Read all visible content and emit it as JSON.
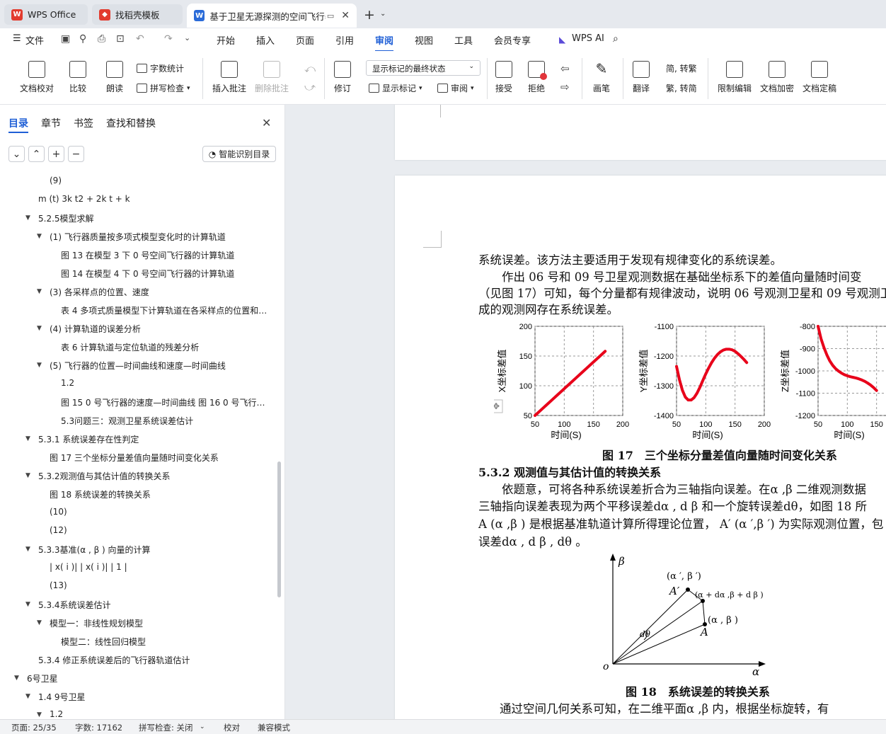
{
  "tabs": {
    "wps": "WPS Office",
    "template": "找稻壳模板",
    "document": "基于卫星无源探测的空间飞行器"
  },
  "menu": {
    "file": "文件",
    "items": [
      "开始",
      "插入",
      "页面",
      "引用",
      "审阅",
      "视图",
      "工具",
      "会员专享"
    ],
    "ai": "WPS AI",
    "active": "审阅"
  },
  "ribbon": {
    "proofread": "文档校对",
    "compare": "比较",
    "read": "朗读",
    "wordcount": "字数统计",
    "spellcheck": "拼写检查",
    "insert_comment": "插入批注",
    "delete_comment": "删除批注",
    "track": "修订",
    "markup_state": "显示标记的最终状态",
    "show_markup": "显示标记",
    "review": "审阅",
    "accept": "接受",
    "reject": "拒绝",
    "pen": "画笔",
    "translate": "翻译",
    "to_trad": "简, 转繁",
    "to_simp": "繁, 转简",
    "restrict": "限制编辑",
    "encrypt": "文档加密",
    "finalize": "文档定稿"
  },
  "nav": {
    "tabs": [
      "目录",
      "章节",
      "书签",
      "查找和替换"
    ],
    "smart_toc": "智能识别目录",
    "items": [
      {
        "text": "(9)",
        "caret": false
      },
      {
        "text": "m (t)  3k t2 + 2k t + k",
        "caret": false
      },
      {
        "text": "5.2.5模型求解",
        "caret": true
      },
      {
        "text": "(1) 飞行器质量按多项式模型变化时的计算轨道",
        "caret": true
      },
      {
        "text": "图 13 在模型 3 下 0 号空间飞行器的计算轨道",
        "caret": false
      },
      {
        "text": "图 14 在模型 4 下 0 号空间飞行器的计算轨道",
        "caret": false
      },
      {
        "text": "(3) 各采样点的位置、速度",
        "caret": true
      },
      {
        "text": "表 4 多项式质量模型下计算轨道在各采样点的位置和…",
        "caret": false
      },
      {
        "text": "(4) 计算轨道的误差分析",
        "caret": true
      },
      {
        "text": "表 6 计算轨道与定位轨道的残差分析",
        "caret": false
      },
      {
        "text": "(5) 飞行器的位置—时间曲线和速度—时间曲线",
        "caret": true
      },
      {
        "text": "1.2",
        "caret": false
      },
      {
        "text": "图 15 0 号飞行器的速度—时间曲线 图 16 0 号飞行…",
        "caret": false
      },
      {
        "text": "5.3问题三：观测卫星系统误差估计",
        "caret": false
      },
      {
        "text": "5.3.1 系统误差存在性判定",
        "caret": true
      },
      {
        "text": "图 17 三个坐标分量差值向量随时间变化关系",
        "caret": false
      },
      {
        "text": "5.3.2观测值与其估计值的转换关系",
        "caret": true
      },
      {
        "text": "图 18 系统误差的转换关系",
        "caret": false
      },
      {
        "text": "(10)",
        "caret": false
      },
      {
        "text": "(12)",
        "caret": false
      },
      {
        "text": "5.3.3基准(α , β ) 向量的计算",
        "caret": true
      },
      {
        "text": "|  x( i )|   |   x( i )|   |  1 |",
        "caret": false
      },
      {
        "text": "(13)",
        "caret": false
      },
      {
        "text": "5.3.4系统误差估计",
        "caret": true
      },
      {
        "text": "模型一：非线性规划模型",
        "caret": true
      },
      {
        "text": "模型二：线性回归模型",
        "caret": false
      },
      {
        "text": "5.3.4 修正系统误差后的飞行器轨道估计",
        "caret": false
      },
      {
        "text": "6号卫星",
        "caret": true
      },
      {
        "text": "1.4 9号卫星",
        "caret": true
      },
      {
        "text": "1.2",
        "caret": true
      }
    ]
  },
  "doc": {
    "lines": [
      "系统误差。该方法主要适用于发现有规律变化的系统误差。",
      "作出 06 号和 09 号卫星观测数据在基础坐标系下的差值向量随时间变",
      "（见图 17）可知，每个分量都有规律波动，说明 06 号观测卫星和 09 号观测卫",
      "成的观测网存在系统误差。"
    ],
    "fig17_caption": "图 17　三个坐标分量差值向量随时间变化关系",
    "heading_532": "5.3.2 观测值与其估计值的转换关系",
    "para2": [
      "依题意，可将各种系统误差折合为三轴指向误差。在α ,β 二维观测数据",
      "三轴指向误差表现为两个平移误差dα , d β 和一个旋转误差dθ，如图 18 所",
      "A (α ,β ) 是根据基准轨道计算所得理论位置， A′ (α ′,β ′) 为实际观测位置，包",
      "误差dα , d β , dθ 。"
    ],
    "fig18_caption": "图 18　系统误差的转换关系",
    "fig18_labels": {
      "beta": "β",
      "alpha": "α",
      "origin": "o",
      "Aprime": "A′",
      "Aprime_coord": "(α ′, β ′)",
      "A": "A",
      "A_coord": "(α , β )",
      "mid": "(α + dα ,β + d β )",
      "dtheta": "dθ"
    },
    "para3": "通过空间几何关系可知，在二维平面α ,β 内，根据坐标旋转，有"
  },
  "chart_data": [
    {
      "type": "line",
      "ylabel": "X坐标差值",
      "xlabel": "时间(S)",
      "xlim": [
        50,
        200
      ],
      "ylim": [
        50,
        200
      ],
      "xticks": [
        50,
        100,
        150,
        200
      ],
      "yticks": [
        50,
        100,
        150,
        200
      ],
      "grid": true,
      "series": [
        {
          "x": [
            50,
            60,
            70,
            80,
            90,
            100,
            110,
            120,
            130,
            140,
            150,
            160,
            170
          ],
          "y": [
            50,
            59,
            68,
            77,
            86,
            95,
            104,
            113,
            122,
            131,
            140,
            149,
            158
          ]
        }
      ]
    },
    {
      "type": "line",
      "ylabel": "Y坐标差值",
      "xlabel": "时间(S)",
      "xlim": [
        50,
        200
      ],
      "ylim": [
        -1400,
        -1100
      ],
      "xticks": [
        50,
        100,
        150,
        200
      ],
      "yticks": [
        -1100,
        -1200,
        -1300,
        -1400
      ],
      "grid": true,
      "series": [
        {
          "x": [
            50,
            55,
            60,
            65,
            70,
            75,
            80,
            85,
            90,
            95,
            100,
            105,
            110,
            115,
            120,
            125,
            130,
            135,
            140,
            145,
            150,
            155,
            160,
            165,
            170
          ],
          "y": [
            -1235,
            -1280,
            -1315,
            -1338,
            -1348,
            -1348,
            -1340,
            -1325,
            -1305,
            -1282,
            -1260,
            -1240,
            -1222,
            -1207,
            -1195,
            -1186,
            -1180,
            -1177,
            -1177,
            -1179,
            -1184,
            -1192,
            -1201,
            -1211,
            -1222
          ]
        }
      ]
    },
    {
      "type": "line",
      "ylabel": "Z坐标差值",
      "xlabel": "时间(S)",
      "xlim": [
        50,
        200
      ],
      "ylim": [
        -1200,
        -800
      ],
      "xticks": [
        50,
        100,
        150
      ],
      "yticks": [
        -800,
        -900,
        -1000,
        -1100,
        -1200
      ],
      "grid": true,
      "series": [
        {
          "x": [
            50,
            55,
            60,
            65,
            70,
            75,
            80,
            85,
            90,
            95,
            100,
            105,
            110,
            115,
            120,
            125,
            130,
            135,
            140,
            145,
            150
          ],
          "y": [
            -800,
            -855,
            -895,
            -928,
            -955,
            -975,
            -990,
            -1001,
            -1010,
            -1017,
            -1022,
            -1026,
            -1029,
            -1032,
            -1036,
            -1041,
            -1047,
            -1055,
            -1064,
            -1075,
            -1088
          ]
        }
      ]
    }
  ],
  "status": {
    "page": "页面: 25/35",
    "words": "字数: 17162",
    "spell": "拼写检查: 关闭",
    "proof": "校对",
    "compat": "兼容模式"
  }
}
